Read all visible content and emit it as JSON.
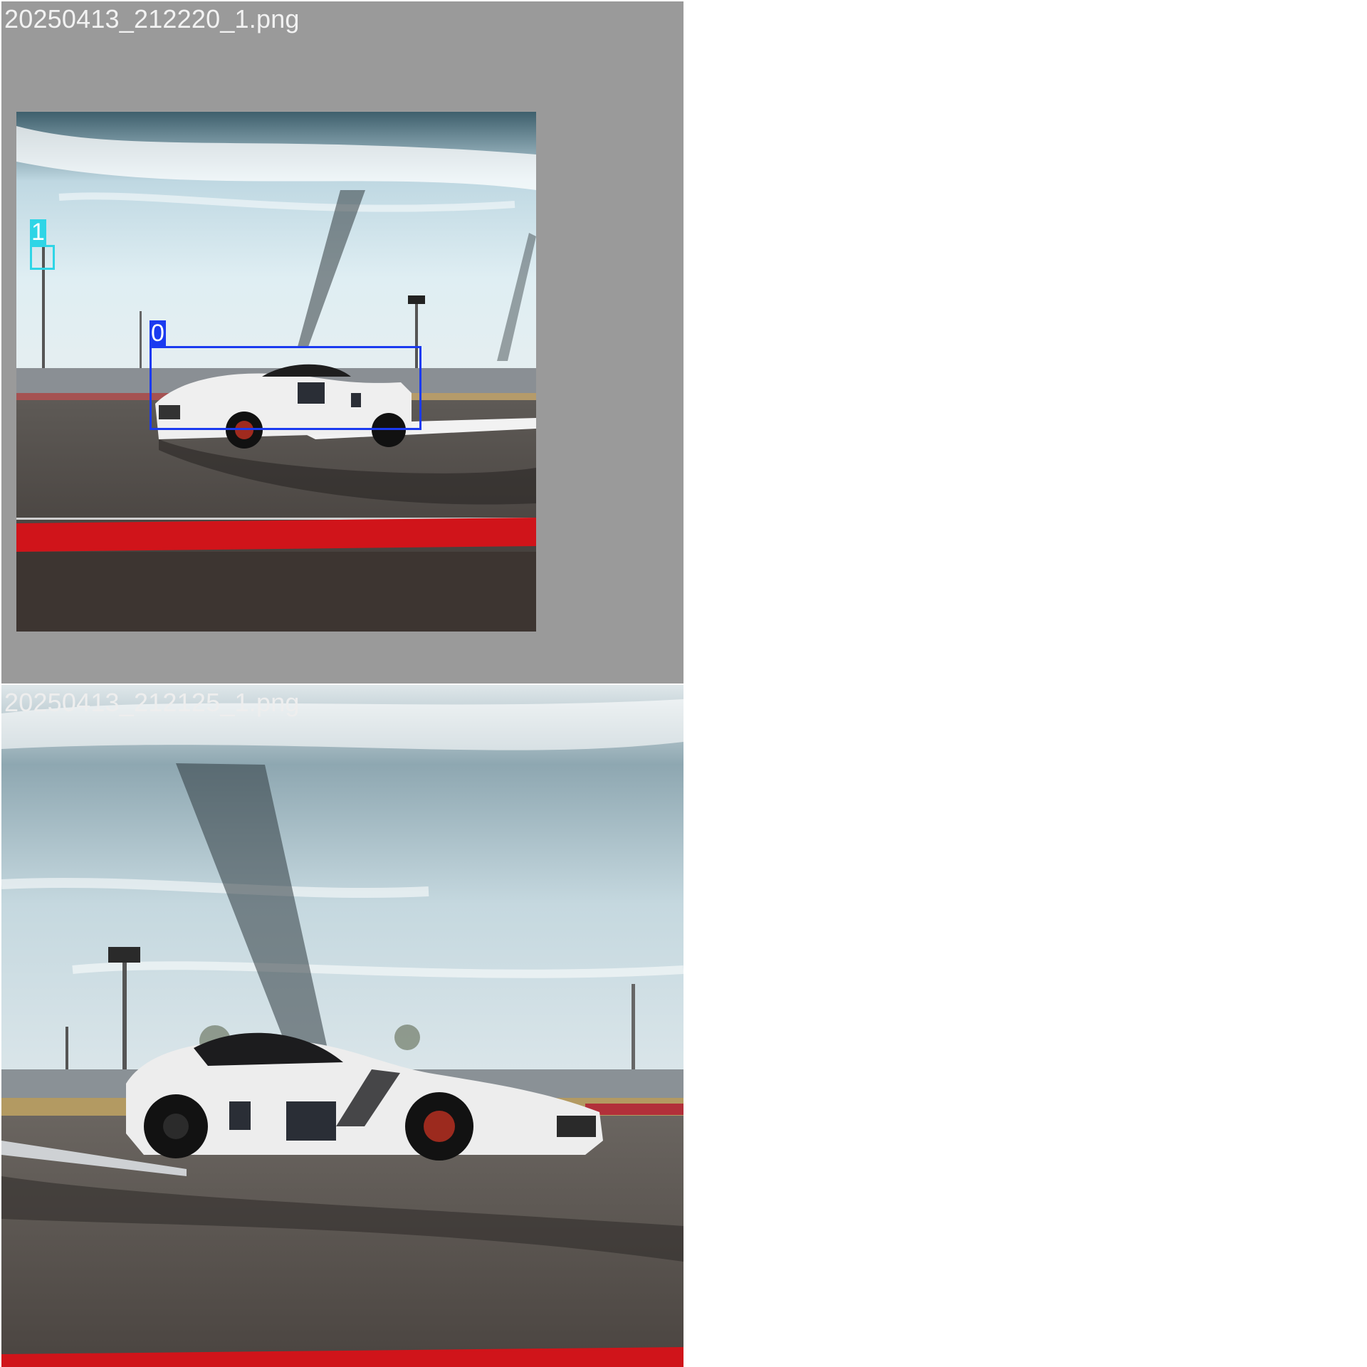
{
  "tiles": [
    {
      "filename": "20250413_212220_1.png",
      "background_color": "#9a9a9a",
      "detections": [
        {
          "label": "0",
          "color": "#1a3af0"
        },
        {
          "label": "1",
          "color": "#2fd5e6"
        }
      ]
    },
    {
      "filename": "20250413_212125_1.png",
      "detections": []
    }
  ]
}
